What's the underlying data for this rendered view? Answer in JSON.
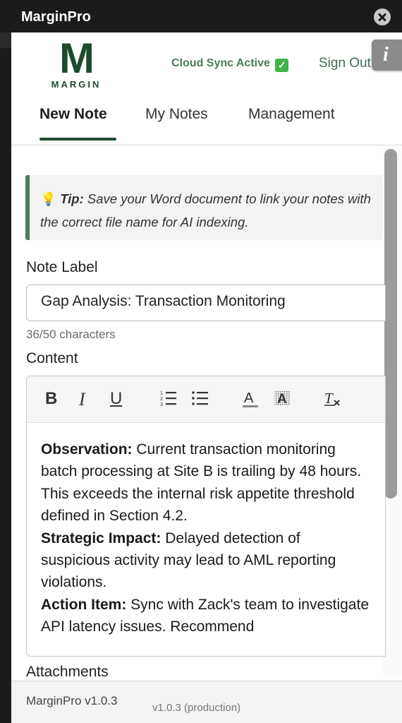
{
  "window": {
    "title": "MarginPro"
  },
  "header": {
    "logo_glyph": "M",
    "logo_word": "MARGIN",
    "sync_status": "Cloud Sync Active",
    "sign_out": "Sign Out",
    "info_glyph": "i"
  },
  "tabs": [
    {
      "label": "New Note",
      "active": true
    },
    {
      "label": "My Notes",
      "active": false
    },
    {
      "label": "Management",
      "active": false
    }
  ],
  "tip": {
    "lead": "Tip:",
    "text": " Save your Word document to link your notes with the correct file name for AI indexing."
  },
  "form": {
    "note_label_title": "Note Label",
    "note_label_value": "Gap Analysis: Transaction Monitoring",
    "char_count": "36/50 characters",
    "content_title": "Content",
    "attachments_title": "Attachments"
  },
  "editor": {
    "toolbar": {
      "bold": "B",
      "italic": "I",
      "underline": "U",
      "numbered_list_icon": "numbered-list-icon",
      "bullet_list_icon": "bullet-list-icon",
      "font_color_icon": "font-color-icon",
      "highlight_icon": "highlight-icon",
      "clear_format_icon": "clear-format-icon"
    },
    "paragraphs": [
      {
        "label": "Observation:",
        "text": " Current transaction monitoring batch processing at Site B is trailing by 48 hours. This exceeds the internal risk appetite threshold defined in Section 4.2."
      },
      {
        "label": "Strategic Impact:",
        "text": " Delayed detection of suspicious activity may lead to AML reporting violations."
      },
      {
        "label": "Action Item:",
        "text": " Sync with Zack's team to investigate API latency issues. Recommend"
      }
    ]
  },
  "footer": {
    "brand": "MarginPro v1.0.3",
    "version": "v1.0.3 (production)"
  },
  "colors": {
    "brand_green": "#1e4a2e",
    "tip_border": "#4d7a5c",
    "sync_green": "#4a7a55"
  }
}
